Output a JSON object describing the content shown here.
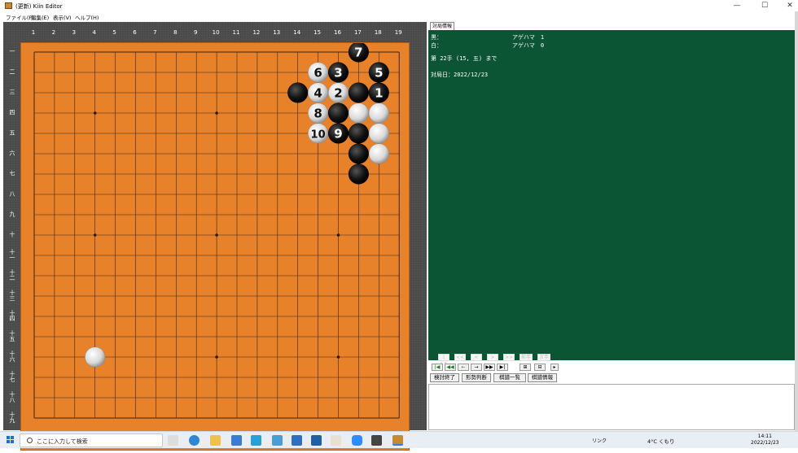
{
  "window": {
    "title": "(更新) Kiin Editor",
    "minimize": "—",
    "maximize": "☐",
    "close": "✕"
  },
  "menu": [
    "ファイル(F)",
    "編集(E)",
    "表示(V)",
    "ヘルプ(H)"
  ],
  "board": {
    "columns": [
      "1",
      "2",
      "3",
      "4",
      "5",
      "6",
      "7",
      "8",
      "9",
      "10",
      "11",
      "12",
      "13",
      "14",
      "15",
      "16",
      "17",
      "18",
      "19"
    ],
    "rows": [
      "一",
      "二",
      "三",
      "四",
      "五",
      "六",
      "七",
      "八",
      "九",
      "十",
      "十一",
      "十二",
      "十三",
      "十四",
      "十五",
      "十六",
      "十七",
      "十八",
      "十九"
    ],
    "stones": [
      {
        "col": 17,
        "row": 1,
        "color": "black",
        "label": "7"
      },
      {
        "col": 15,
        "row": 2,
        "color": "white",
        "label": "6"
      },
      {
        "col": 16,
        "row": 2,
        "color": "black",
        "label": "3"
      },
      {
        "col": 18,
        "row": 2,
        "color": "black",
        "label": "5"
      },
      {
        "col": 14,
        "row": 3,
        "color": "black",
        "label": ""
      },
      {
        "col": 15,
        "row": 3,
        "color": "white",
        "label": "4"
      },
      {
        "col": 16,
        "row": 3,
        "color": "white",
        "label": "2"
      },
      {
        "col": 17,
        "row": 3,
        "color": "black",
        "label": ""
      },
      {
        "col": 18,
        "row": 3,
        "color": "black",
        "label": "1"
      },
      {
        "col": 15,
        "row": 4,
        "color": "white",
        "label": "8"
      },
      {
        "col": 16,
        "row": 4,
        "color": "black",
        "label": ""
      },
      {
        "col": 17,
        "row": 4,
        "color": "white",
        "label": ""
      },
      {
        "col": 18,
        "row": 4,
        "color": "white",
        "label": ""
      },
      {
        "col": 15,
        "row": 5,
        "color": "white",
        "label": "10"
      },
      {
        "col": 16,
        "row": 5,
        "color": "black",
        "label": "9"
      },
      {
        "col": 17,
        "row": 5,
        "color": "black",
        "label": ""
      },
      {
        "col": 18,
        "row": 5,
        "color": "white",
        "label": ""
      },
      {
        "col": 17,
        "row": 6,
        "color": "black",
        "label": ""
      },
      {
        "col": 18,
        "row": 6,
        "color": "white",
        "label": ""
      },
      {
        "col": 17,
        "row": 7,
        "color": "black",
        "label": ""
      },
      {
        "col": 4,
        "row": 16,
        "color": "white",
        "label": ""
      }
    ]
  },
  "info": {
    "tab": "対局情報",
    "black_label": "黒：",
    "white_label": "白：",
    "black_captures": "アゲハマ　1",
    "white_captures": "アゲハマ　0",
    "move_text": "第 22手 (15, 五) まで",
    "date_text": "対局日：2022/12/23"
  },
  "nav_disabled": [
    "|<<",
    "<<",
    "<",
    ">",
    ">>",
    "前手",
    "次手"
  ],
  "nav_enabled": [
    "|◀",
    "◀◀",
    "←",
    "→",
    "▶▶",
    "▶|",
    "⊞",
    "⊟",
    "▸"
  ],
  "actions": [
    "検討終了",
    "形勢判断",
    "棋譜一覧",
    "棋譜情報"
  ],
  "taskbar": {
    "search_placeholder": "ここに入力して検索",
    "link_label": "リンク",
    "weather": "4°C くもり",
    "time": "14:11",
    "date": "2022/12/23"
  },
  "colors": {
    "board": "#e8822a",
    "panel": "#0c5534",
    "frame": "#4a4a4a"
  }
}
